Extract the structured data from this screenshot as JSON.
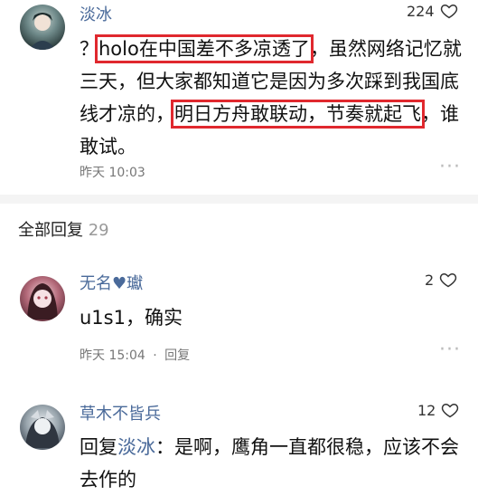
{
  "top_comment": {
    "username": "淡冰",
    "likes": "224",
    "text_prefix": "？",
    "highlight1": "holo在中国差不多凉透了",
    "text_mid1": "，虽然网络记忆就三天，但大家都知道它是因为多次踩到我国底线才凉的，",
    "highlight2": "明日方舟敢联动，节奏就起飞",
    "text_end": "，谁敢试。",
    "timestamp": "昨天 10:03"
  },
  "replies_section": {
    "title": "全部回复",
    "count": "29"
  },
  "reply1": {
    "username_name": "无名",
    "username_suffix": "♥瓛",
    "likes": "2",
    "text": "u1s1，确实",
    "timestamp": "昨天 15:04",
    "separator": "·",
    "reply_label": "回复"
  },
  "reply2": {
    "username": "草木不皆兵",
    "likes": "12",
    "reply_prefix": "回复",
    "reply_target": "淡冰",
    "reply_colon": "：",
    "text": "是啊，鹰角一直都很稳，应该不会去作的"
  },
  "icons": {
    "heart": "heart-icon",
    "more": "more-icon"
  },
  "colors": {
    "username": "#4a6a9a",
    "highlight_border": "#e0282e"
  }
}
